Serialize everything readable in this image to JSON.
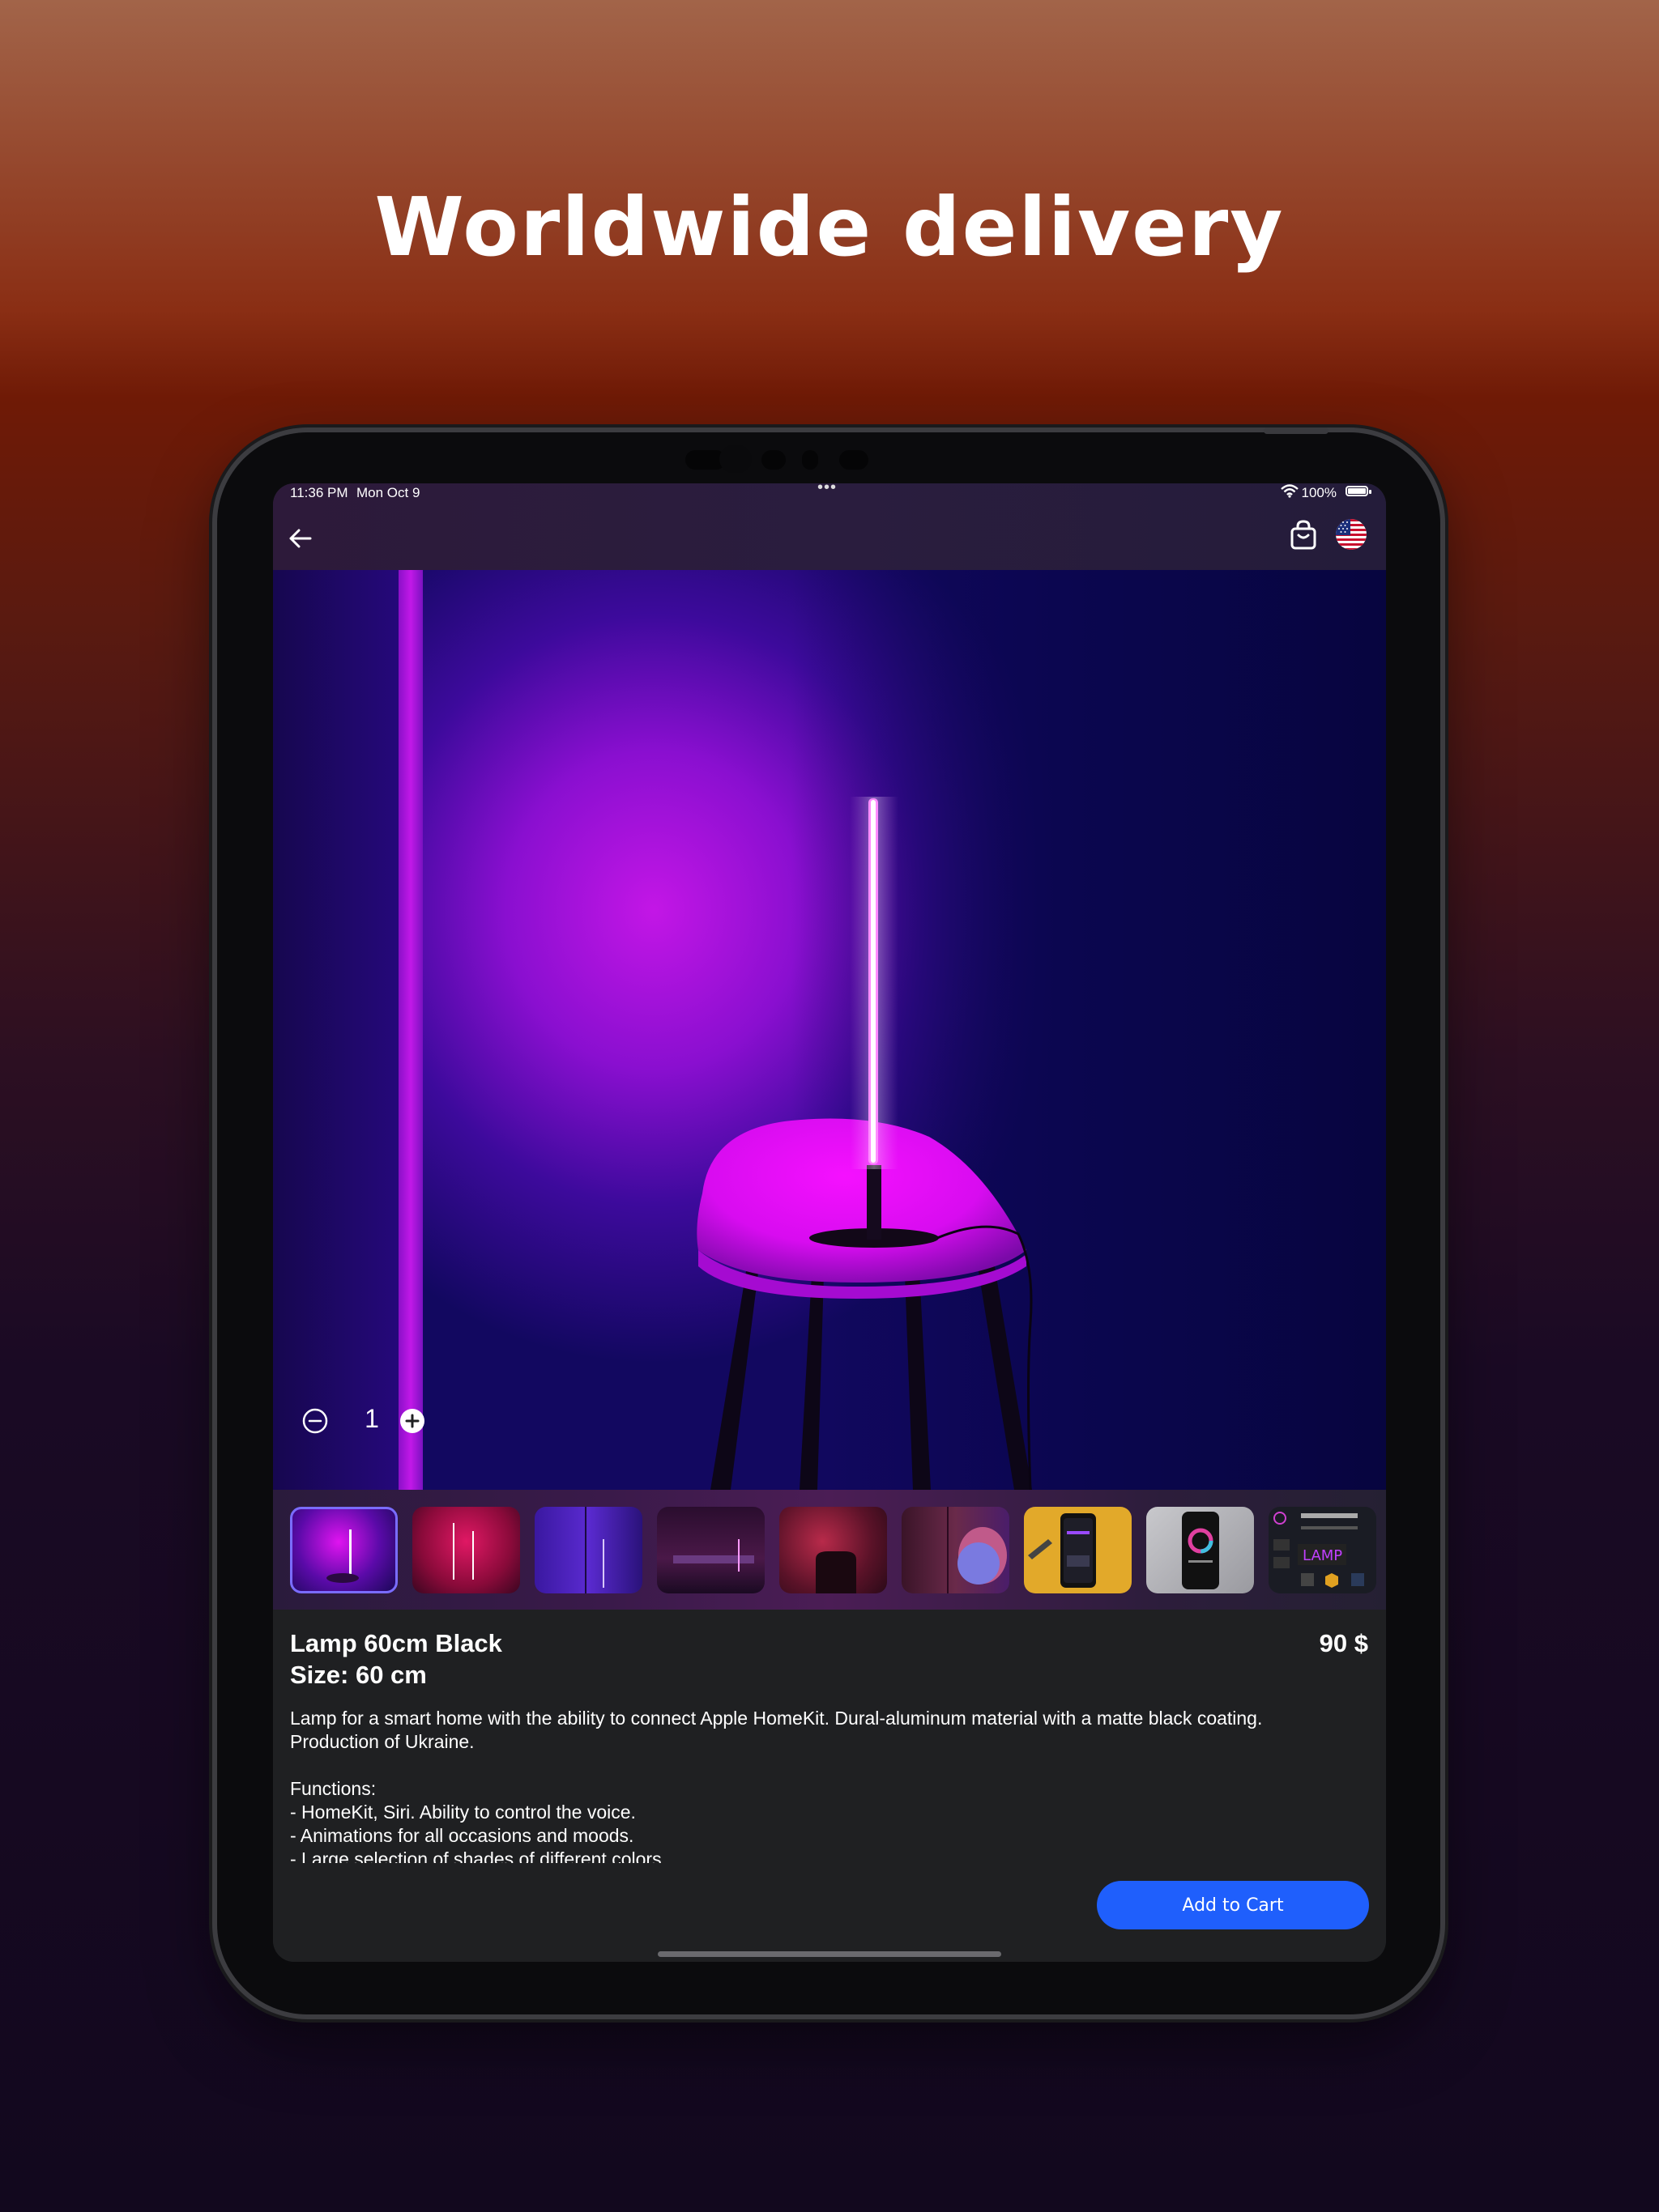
{
  "headline": "Worldwide delivery",
  "status_bar": {
    "time": "11:36 PM",
    "date": "Mon Oct 9",
    "battery": "100%"
  },
  "nav": {
    "back_icon": "arrow-left-icon",
    "cart_icon": "shopping-bag-icon",
    "flag_icon": "us-flag-icon"
  },
  "product": {
    "name": "Lamp 60cm Black",
    "size": "Size: 60 cm",
    "price": "90 $",
    "description": "Lamp for a smart home with the ability to connect Apple HomeKit. Dural-aluminum material with a matte black coating.\nProduction of Ukraine.\n\nFunctions:\n- HomeKit, Siri. Ability to control the voice.\n- Animations for all occasions and moods.\n- Large selection of shades of different colors."
  },
  "thumbnails": {
    "count": 9,
    "selected_index": 0,
    "last_thumb_text": "LAMP"
  },
  "cart": {
    "quantity": "1",
    "add_label": "Add to Cart"
  },
  "colors": {
    "accent": "#1f5ffc",
    "selection": "#7a6cff",
    "panel": "#1f2022"
  }
}
